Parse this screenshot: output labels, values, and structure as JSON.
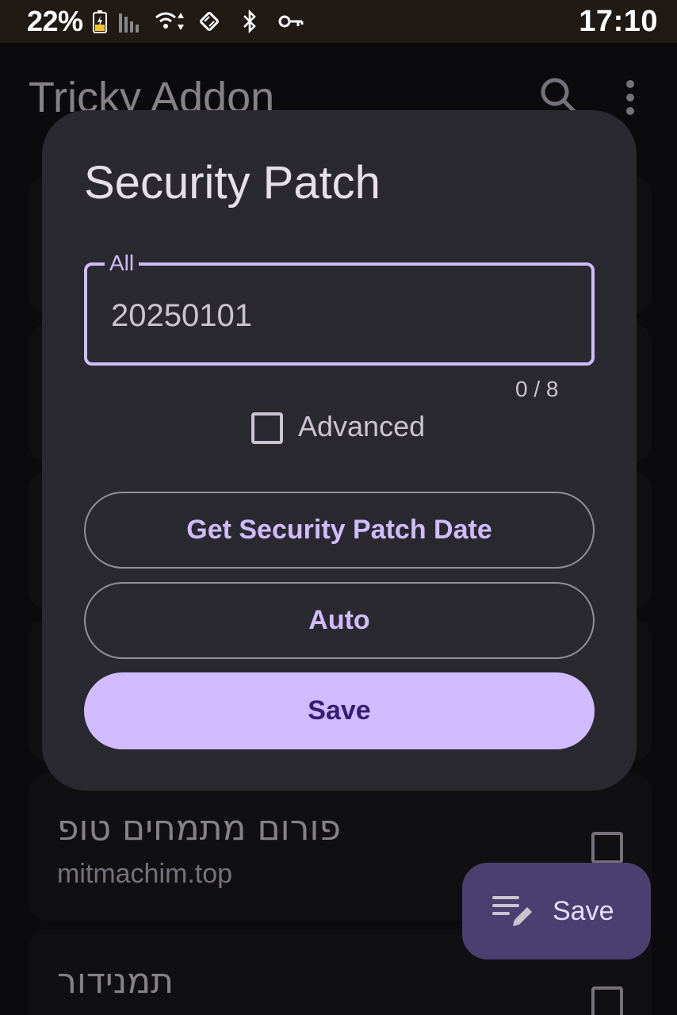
{
  "status_bar": {
    "battery": "22%",
    "time": "17:10",
    "icons": [
      "battery-charging-icon",
      "signal-icon",
      "wifi-icon",
      "rotate-icon",
      "bluetooth-icon",
      "vpn-key-icon"
    ]
  },
  "app_bar": {
    "title": "Tricky Addon",
    "icons": [
      "search-icon",
      "more-vert-icon"
    ]
  },
  "app_list": {
    "items": [
      {
        "name": "פורום מתמחים טופ",
        "package": "mitmachim.top"
      },
      {
        "name": "תמנידור",
        "package": ""
      }
    ]
  },
  "fab": {
    "label": "Save",
    "icon": "edit-list-icon"
  },
  "dialog": {
    "title": "Security Patch",
    "field_label": "All",
    "field_value": "20250101",
    "counter": "0 / 8",
    "advanced_label": "Advanced",
    "advanced_checked": false,
    "get_date_label": "Get Security Patch Date",
    "auto_label": "Auto",
    "save_label": "Save"
  },
  "colors": {
    "background": "#141318",
    "dialog_surface": "#2b2930",
    "primary": "#d0bcff",
    "on_primary": "#381e72",
    "fab_container": "#4a4070"
  }
}
